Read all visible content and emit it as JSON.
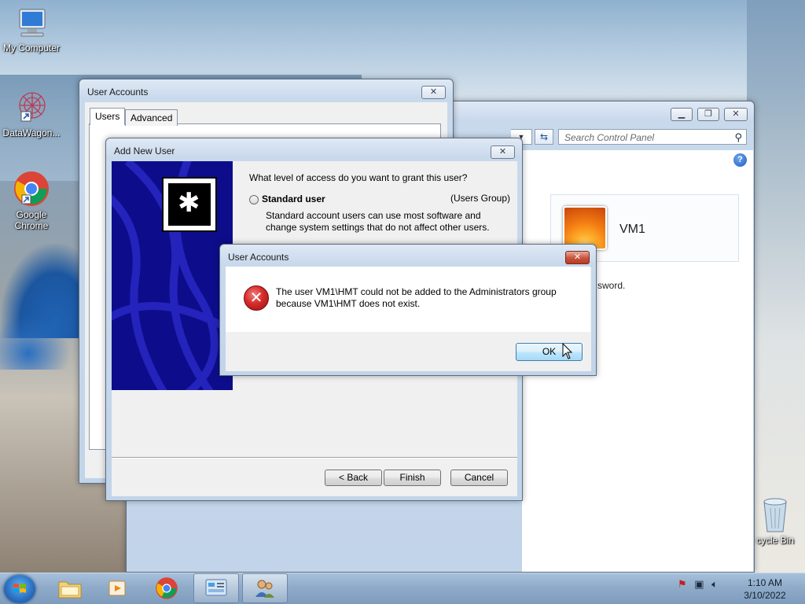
{
  "desktop": {
    "icons": [
      {
        "label": "My Computer"
      },
      {
        "label": "DataWagon..."
      },
      {
        "label": "Google Chrome"
      },
      {
        "label": "cycle Bin"
      }
    ]
  },
  "control_panel": {
    "search_placeholder": "Search Control Panel",
    "user_name": "VM1",
    "partial_text": "sword.",
    "help_glyph": "?"
  },
  "user_accounts": {
    "title": "User Accounts",
    "tabs": [
      "Users",
      "Advanced"
    ],
    "close_glyph": "✕"
  },
  "add_new_user": {
    "title": "Add New User",
    "question": "What level of access do you want to grant this user?",
    "option_label": "Standard user",
    "option_group": "(Users Group)",
    "option_description": "Standard account users can use most software and change system settings that do not affect other users.",
    "buttons": {
      "back": "< Back",
      "finish": "Finish",
      "cancel": "Cancel"
    }
  },
  "error_dialog": {
    "title": "User Accounts",
    "message_line1": "The user VM1\\HMT could not be added to the Administrators group",
    "message_line2": "because VM1\\HMT does not exist.",
    "ok_label": "OK",
    "icon": "error-icon"
  },
  "taskbar": {
    "time": "1:10 AM",
    "date": "3/10/2022"
  },
  "colors": {
    "error_red": "#d62b2b",
    "wizard_banner": "#0d0d8c",
    "taskbar": "#8fabc9"
  }
}
